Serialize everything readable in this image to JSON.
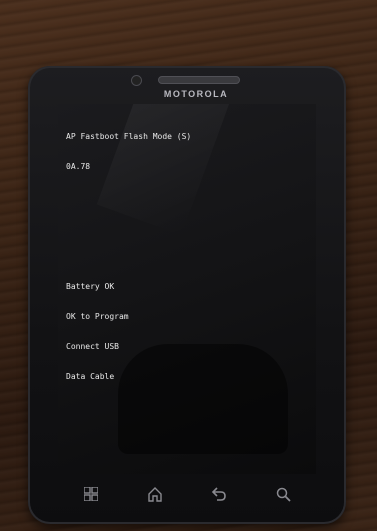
{
  "device": {
    "brand": "MOTOROLA"
  },
  "screen": {
    "lines_top": [
      "AP Fastboot Flash Mode (S)",
      "0A.78"
    ],
    "lines_bottom": [
      "Battery OK",
      "OK to Program",
      "Connect USB",
      "Data Cable"
    ]
  },
  "nav_keys": [
    {
      "icon": "menu-grid-icon"
    },
    {
      "icon": "home-icon"
    },
    {
      "icon": "back-icon"
    },
    {
      "icon": "search-icon"
    }
  ],
  "colors": {
    "text": "#e9e9e9",
    "bezel": "#121214",
    "screen": "#141416",
    "wood": "#3a2416"
  }
}
